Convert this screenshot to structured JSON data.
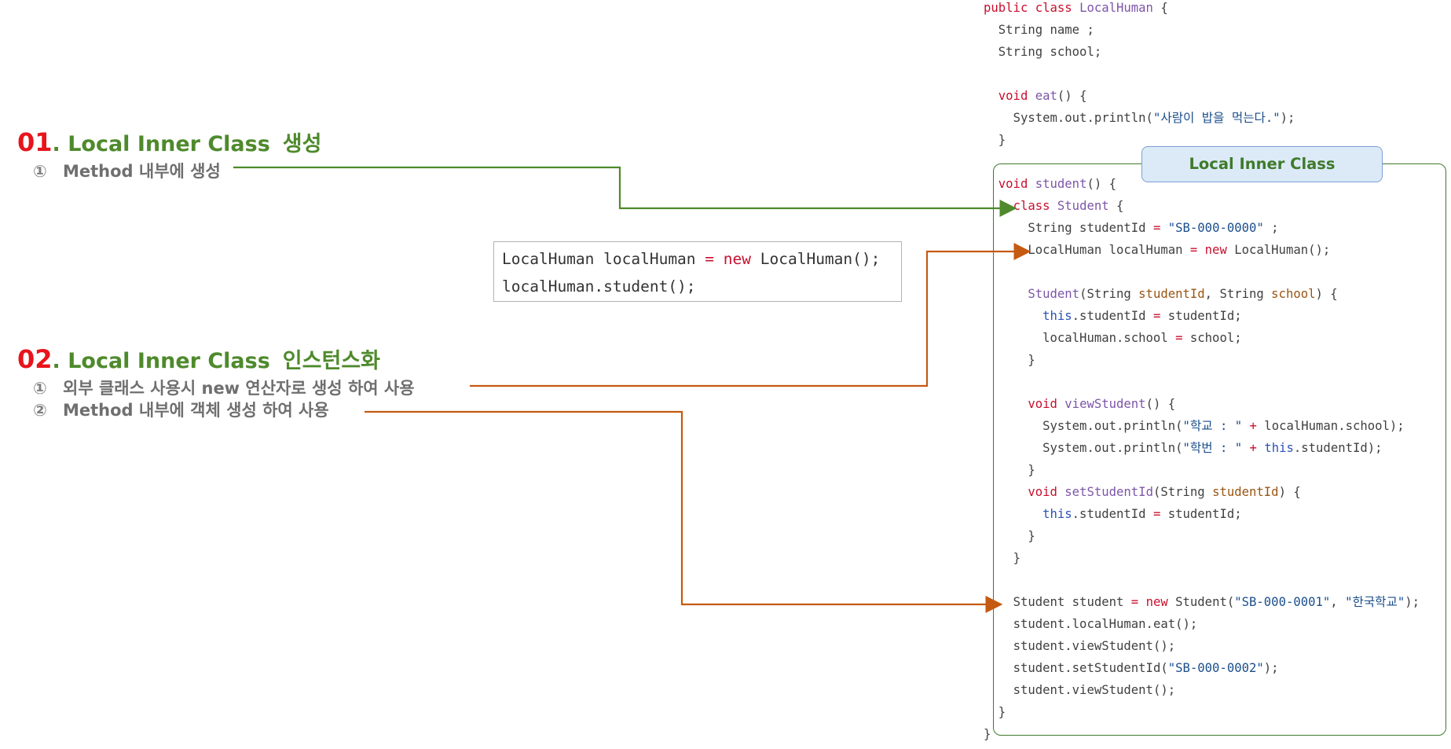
{
  "sections": [
    {
      "number": "01",
      "dot": ".",
      "title": "Local Inner Class",
      "title_kr": "생성",
      "items": [
        {
          "mark": "①",
          "text": "Method 내부에 생성"
        }
      ]
    },
    {
      "number": "02",
      "dot": ".",
      "title": "Local Inner Class",
      "title_kr": "인스턴스화",
      "items": [
        {
          "mark": "①",
          "text": "외부 클래스 사용시 new 연산자로 생성 하여 사용"
        },
        {
          "mark": "②",
          "text": "Method 내부에 객체 생성 하여 사용"
        }
      ]
    }
  ],
  "snippet": {
    "lines": [
      [
        {
          "t": "LocalHuman localHuman "
        },
        {
          "t": "=",
          "c": "kw"
        },
        {
          "t": " "
        },
        {
          "t": "new",
          "c": "kw"
        },
        {
          "t": " LocalHuman();"
        }
      ],
      [
        {
          "t": "localHuman.student();"
        }
      ]
    ]
  },
  "box_label": "Local Inner Class",
  "code": [
    {
      "indent": 0,
      "tokens": [
        {
          "t": "public class ",
          "c": "kw"
        },
        {
          "t": "LocalHuman",
          "c": "ty"
        },
        {
          "t": " {"
        }
      ]
    },
    {
      "indent": 1,
      "tokens": [
        {
          "t": "String name ;"
        }
      ]
    },
    {
      "indent": 1,
      "tokens": [
        {
          "t": "String school;"
        }
      ]
    },
    {
      "indent": 0,
      "tokens": []
    },
    {
      "indent": 1,
      "tokens": [
        {
          "t": "void ",
          "c": "kw"
        },
        {
          "t": "eat",
          "c": "ty"
        },
        {
          "t": "() {"
        }
      ]
    },
    {
      "indent": 2,
      "tokens": [
        {
          "t": "System.out.println("
        },
        {
          "t": "\"사람이 밥을 먹는다.\"",
          "c": "st"
        },
        {
          "t": ");"
        }
      ]
    },
    {
      "indent": 1,
      "tokens": [
        {
          "t": "}"
        }
      ]
    },
    {
      "indent": 0,
      "tokens": []
    },
    {
      "indent": 1,
      "tokens": [
        {
          "t": "void ",
          "c": "kw"
        },
        {
          "t": "student",
          "c": "ty"
        },
        {
          "t": "() {"
        }
      ]
    },
    {
      "indent": 2,
      "tokens": [
        {
          "t": "class ",
          "c": "kw"
        },
        {
          "t": "Student",
          "c": "ty"
        },
        {
          "t": " {"
        }
      ]
    },
    {
      "indent": 3,
      "tokens": [
        {
          "t": "String studentId "
        },
        {
          "t": "=",
          "c": "kw"
        },
        {
          "t": " "
        },
        {
          "t": "\"SB-000-0000\"",
          "c": "st"
        },
        {
          "t": " ;"
        }
      ]
    },
    {
      "indent": 3,
      "tokens": [
        {
          "t": "LocalHuman localHuman "
        },
        {
          "t": "=",
          "c": "kw"
        },
        {
          "t": " "
        },
        {
          "t": "new",
          "c": "kw"
        },
        {
          "t": " LocalHuman();"
        }
      ]
    },
    {
      "indent": 0,
      "tokens": []
    },
    {
      "indent": 3,
      "tokens": [
        {
          "t": "Student",
          "c": "ty"
        },
        {
          "t": "(String "
        },
        {
          "t": "studentId",
          "c": "pa"
        },
        {
          "t": ", String "
        },
        {
          "t": "school",
          "c": "pa"
        },
        {
          "t": ") {"
        }
      ]
    },
    {
      "indent": 4,
      "tokens": [
        {
          "t": "this",
          "c": "th"
        },
        {
          "t": ".studentId "
        },
        {
          "t": "=",
          "c": "kw"
        },
        {
          "t": " studentId;"
        }
      ]
    },
    {
      "indent": 4,
      "tokens": [
        {
          "t": "localHuman.school "
        },
        {
          "t": "=",
          "c": "kw"
        },
        {
          "t": " school;"
        }
      ]
    },
    {
      "indent": 3,
      "tokens": [
        {
          "t": "}"
        }
      ]
    },
    {
      "indent": 0,
      "tokens": []
    },
    {
      "indent": 3,
      "tokens": [
        {
          "t": "void ",
          "c": "kw"
        },
        {
          "t": "viewStudent",
          "c": "ty"
        },
        {
          "t": "() {"
        }
      ]
    },
    {
      "indent": 4,
      "tokens": [
        {
          "t": "System.out.println("
        },
        {
          "t": "\"학교 : \"",
          "c": "st"
        },
        {
          "t": " "
        },
        {
          "t": "+",
          "c": "kw"
        },
        {
          "t": " localHuman.school);"
        }
      ]
    },
    {
      "indent": 4,
      "tokens": [
        {
          "t": "System.out.println("
        },
        {
          "t": "\"학번 : \"",
          "c": "st"
        },
        {
          "t": " "
        },
        {
          "t": "+",
          "c": "kw"
        },
        {
          "t": " "
        },
        {
          "t": "this",
          "c": "th"
        },
        {
          "t": ".studentId);"
        }
      ]
    },
    {
      "indent": 3,
      "tokens": [
        {
          "t": "}"
        }
      ]
    },
    {
      "indent": 3,
      "tokens": [
        {
          "t": "void ",
          "c": "kw"
        },
        {
          "t": "setStudentId",
          "c": "ty"
        },
        {
          "t": "(String "
        },
        {
          "t": "studentId",
          "c": "pa"
        },
        {
          "t": ") {"
        }
      ]
    },
    {
      "indent": 4,
      "tokens": [
        {
          "t": "this",
          "c": "th"
        },
        {
          "t": ".studentId "
        },
        {
          "t": "=",
          "c": "kw"
        },
        {
          "t": " studentId;"
        }
      ]
    },
    {
      "indent": 3,
      "tokens": [
        {
          "t": "}"
        }
      ]
    },
    {
      "indent": 2,
      "tokens": [
        {
          "t": "}"
        }
      ]
    },
    {
      "indent": 0,
      "tokens": []
    },
    {
      "indent": 2,
      "tokens": [
        {
          "t": "Student student "
        },
        {
          "t": "=",
          "c": "kw"
        },
        {
          "t": " "
        },
        {
          "t": "new",
          "c": "kw"
        },
        {
          "t": " Student("
        },
        {
          "t": "\"SB-000-0001\"",
          "c": "st"
        },
        {
          "t": ", "
        },
        {
          "t": "\"한국학교\"",
          "c": "st"
        },
        {
          "t": ");"
        }
      ]
    },
    {
      "indent": 2,
      "tokens": [
        {
          "t": "student.localHuman.eat();"
        }
      ]
    },
    {
      "indent": 2,
      "tokens": [
        {
          "t": "student.viewStudent();"
        }
      ]
    },
    {
      "indent": 2,
      "tokens": [
        {
          "t": "student.setStudentId("
        },
        {
          "t": "\"SB-000-0002\"",
          "c": "st"
        },
        {
          "t": ");"
        }
      ]
    },
    {
      "indent": 2,
      "tokens": [
        {
          "t": "student.viewStudent();"
        }
      ]
    },
    {
      "indent": 1,
      "tokens": [
        {
          "t": "}"
        }
      ]
    },
    {
      "indent": 0,
      "tokens": [
        {
          "t": "}"
        }
      ]
    }
  ],
  "colors": {
    "heading_number": "#e8141b",
    "heading_title": "#4e8a2c",
    "connector_green": "#4e8a2c",
    "connector_orange": "#c55a11",
    "box_border": "#3f7a2a",
    "label_fill": "#dceaf8"
  }
}
